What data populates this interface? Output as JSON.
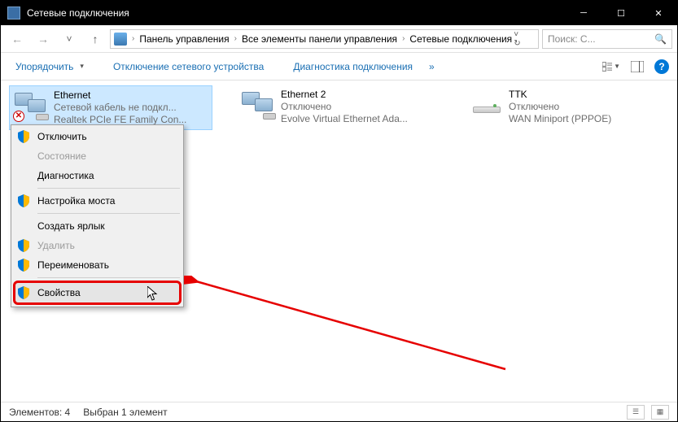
{
  "window": {
    "title": "Сетевые подключения"
  },
  "breadcrumb": {
    "root": "Панель управления",
    "mid": "Все элементы панели управления",
    "leaf": "Сетевые подключения"
  },
  "search": {
    "placeholder": "Поиск: С..."
  },
  "toolbar": {
    "organize": "Упорядочить",
    "disable": "Отключение сетевого устройства",
    "diagnose": "Диагностика подключения",
    "more": "»"
  },
  "connections": [
    {
      "name": "Ethernet",
      "status": "Сетевой кабель не подкл...",
      "device": "Realtek PCIe FE Family Con..."
    },
    {
      "name": "Ethernet 2",
      "status": "Отключено",
      "device": "Evolve Virtual Ethernet Ada..."
    },
    {
      "name": "TTK",
      "status": "Отключено",
      "device": "WAN Miniport (PPPOE)"
    }
  ],
  "context_menu": {
    "disable": "Отключить",
    "status": "Состояние",
    "diagnose": "Диагностика",
    "bridge": "Настройка моста",
    "shortcut": "Создать ярлык",
    "delete": "Удалить",
    "rename": "Переименовать",
    "properties": "Свойства"
  },
  "statusbar": {
    "count_label": "Элементов: 4",
    "selected_label": "Выбран 1 элемент"
  }
}
